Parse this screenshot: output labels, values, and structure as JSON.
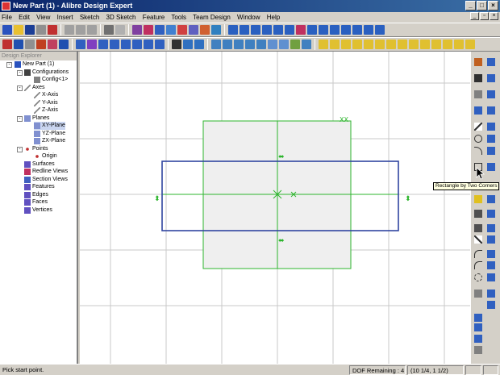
{
  "window": {
    "title": "New Part (1) - Alibre Design Expert",
    "minimize": "_",
    "maximize": "□",
    "close": "×"
  },
  "menu": {
    "items": [
      "File",
      "Edit",
      "View",
      "Insert",
      "Sketch",
      "3D Sketch",
      "Feature",
      "Tools",
      "Team Design",
      "Window",
      "Help"
    ]
  },
  "explorer": {
    "header": "Design Explorer",
    "root": "New Part (1)",
    "configurations": "Configurations",
    "config1": "Config<1>",
    "axes": "Axes",
    "x_axis": "X-Axis",
    "y_axis": "Y-Axis",
    "z_axis": "Z-Axis",
    "planes": "Planes",
    "xy_plane": "XY-Plane",
    "yz_plane": "YZ-Plane",
    "zx_plane": "ZX-Plane",
    "points": "Points",
    "origin": "Origin",
    "surfaces": "Surfaces",
    "redline_views": "Redline Views",
    "section_views": "Section Views",
    "features": "Features",
    "edges": "Edges",
    "faces": "Faces",
    "vertices": "Vertices"
  },
  "tooltip": "Rectangle by Two Corners",
  "status": {
    "prompt": "Pick start point.",
    "dof": "DOF Remaining : 4",
    "coords": "(10 1/4, 1 1/2)"
  },
  "colors": {
    "title_start": "#0a246a",
    "title_end": "#3a6ea5",
    "grid": "#c8c8c8",
    "sketch_blue": "#3045a0",
    "plane_green": "#2db52d",
    "plane_fill": "#efefef"
  }
}
